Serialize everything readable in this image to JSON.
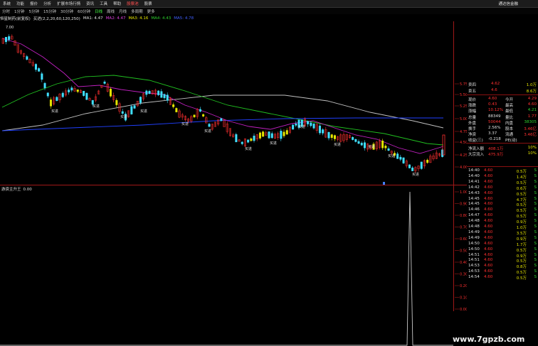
{
  "menu": {
    "items": [
      "系统",
      "功能",
      "报价",
      "分析",
      "扩展市场行情",
      "资讯",
      "工具",
      "帮助",
      "股票池",
      "股票"
    ],
    "active_index": 8,
    "brand": "通达信金融"
  },
  "periods": {
    "items": [
      "分时",
      "1分钟",
      "5分钟",
      "15分钟",
      "30分钟",
      "60分钟",
      "日线",
      "周线",
      "月线",
      "多周期",
      "更多"
    ],
    "active_index": 6
  },
  "indicator_bar": {
    "title": "恒星制药(前复权)",
    "formula": "买进(2,2,20,60,120,250)",
    "ma1": "MA1: 4.47",
    "ma2": "MA2: 4.47",
    "ma3": "MA3: 4.16",
    "ma4": "MA4: 4.43",
    "ma5": "MA5: 4.78"
  },
  "main_chart": {
    "y_ticks": [
      "5.75",
      "5.50",
      "5.25",
      "5.00",
      "4.75",
      "4.50",
      "4.25",
      "4.00"
    ],
    "top_price": "7.00",
    "buy_label": "买进",
    "colors": {
      "up": "#ff3030",
      "down": "#40e0ff",
      "ma20": "#c020c0",
      "ma60": "#20c020",
      "ma120": "#c0c0c0",
      "ma250": "#2040ff",
      "yellow": "#e6e600"
    }
  },
  "sub_chart": {
    "title": "游资主升王",
    "value": "0.00",
    "y_ticks": [
      "1.00",
      "0.90",
      "0.80",
      "0.70",
      "0.60",
      "0.50",
      "0.40",
      "0.30",
      "0.20",
      "0.10",
      "0.00"
    ]
  },
  "quote_panel": {
    "sell4": {
      "label": "卖四",
      "price": "4.62",
      "vol": "1.0万"
    },
    "sell5": {
      "label": "卖五",
      "price": "4.6",
      "vol": "8.6万"
    },
    "rows": [
      {
        "l1": "现价",
        "v1": "4.60",
        "l2": "今开",
        "v2": "4.29"
      },
      {
        "l1": "涨跌",
        "v1": "0.43",
        "l2": "最高",
        "v2": "4.60"
      },
      {
        "l1": "涨幅",
        "v1": "10.12%",
        "l2": "最低",
        "v2": "4.21"
      },
      {
        "l1": "总量",
        "v1": "88349",
        "l2": "量比",
        "v2": "1.77"
      },
      {
        "l1": "外盘",
        "v1": "50044",
        "l2": "内盘",
        "v2": "38305"
      },
      {
        "l1": "换手",
        "v1": "2.56%",
        "l2": "股本",
        "v2": "3.46亿"
      },
      {
        "l1": "净资",
        "v1": "3.37",
        "l2": "流通",
        "v2": "3.46亿"
      },
      {
        "l1": "收益(三)",
        "v1": "-0.218",
        "l2": "PE(动)",
        "v2": ""
      },
      {
        "l1": "净流入额",
        "v1": "408.1万",
        "l2": "",
        "v2": "10%"
      },
      {
        "l1": "大宗流入",
        "v1": "475.9万",
        "l2": "",
        "v2": "10%"
      }
    ]
  },
  "trades": [
    {
      "time": "14:40",
      "price": "4.60",
      "vol": "0.5万",
      "dir": "S"
    },
    {
      "time": "14:40",
      "price": "4.60",
      "vol": "1.4万",
      "dir": "S"
    },
    {
      "time": "14:41",
      "price": "4.60",
      "vol": "0.5万",
      "dir": "S"
    },
    {
      "time": "14:42",
      "price": "4.60",
      "vol": "0.6万",
      "dir": "S"
    },
    {
      "time": "14:43",
      "price": "4.60",
      "vol": "0.5万",
      "dir": "S"
    },
    {
      "time": "14:45",
      "price": "4.60",
      "vol": "4.7万",
      "dir": "S"
    },
    {
      "time": "14:45",
      "price": "4.60",
      "vol": "0.5万",
      "dir": "S"
    },
    {
      "time": "14:46",
      "price": "4.60",
      "vol": "0.5万",
      "dir": "S"
    },
    {
      "time": "14:47",
      "price": "4.60",
      "vol": "0.5万",
      "dir": "S"
    },
    {
      "time": "14:48",
      "price": "4.60",
      "vol": "0.9万",
      "dir": "S"
    },
    {
      "time": "14:48",
      "price": "4.60",
      "vol": "1.0万",
      "dir": "S"
    },
    {
      "time": "14:49",
      "price": "4.60",
      "vol": "3.5万",
      "dir": "S"
    },
    {
      "time": "14:49",
      "price": "4.60",
      "vol": "0.9万",
      "dir": "S"
    },
    {
      "time": "14:50",
      "price": "4.60",
      "vol": "1.7万",
      "dir": "S"
    },
    {
      "time": "14:50",
      "price": "4.60",
      "vol": "0.5万",
      "dir": "S"
    },
    {
      "time": "14:51",
      "price": "4.60",
      "vol": "0.9万",
      "dir": "S"
    },
    {
      "time": "14:51",
      "price": "4.60",
      "vol": "0.5万",
      "dir": "S"
    },
    {
      "time": "14:53",
      "price": "4.60",
      "vol": "0.8万",
      "dir": "S"
    },
    {
      "time": "14:53",
      "price": "4.60",
      "vol": "0.5万",
      "dir": "S"
    },
    {
      "time": "14:54",
      "price": "4.60",
      "vol": "0.5万",
      "dir": "S"
    }
  ],
  "watermark": "www.7gpzb.com"
}
